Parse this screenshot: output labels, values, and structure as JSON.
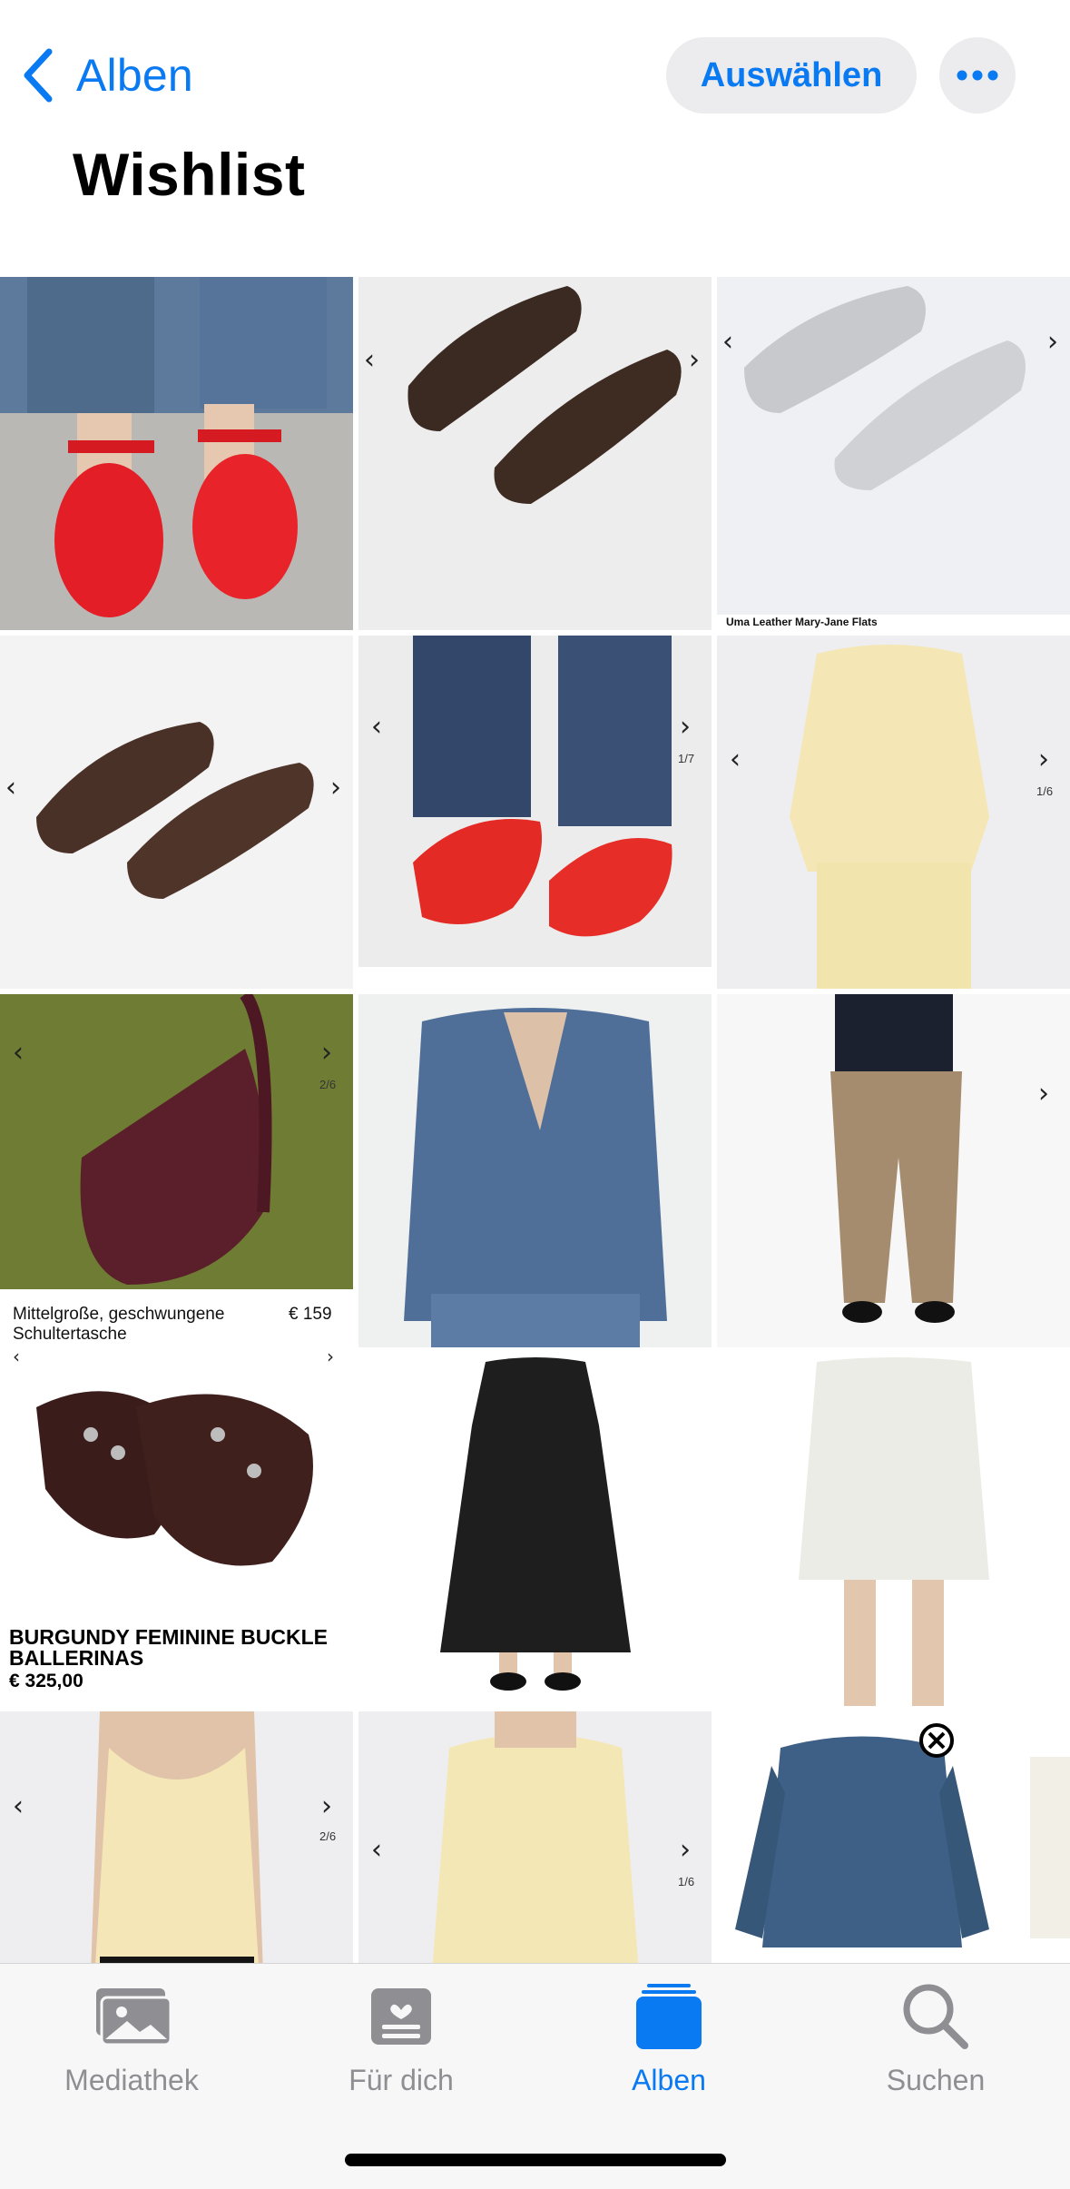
{
  "header": {
    "back_label": "Alben",
    "select_label": "Auswählen",
    "more_icon": "ellipsis-icon",
    "title": "Wishlist"
  },
  "colors": {
    "accent": "#0A7AF3",
    "inactive": "#8E8E93",
    "pill_bg": "#ECECEE"
  },
  "grid": {
    "tiles": [
      {
        "desc": "red mary-jane ballet flats with jeans"
      },
      {
        "desc": "brown suede ballet flats"
      },
      {
        "desc": "silver mary-jane flats",
        "caption": "Uma Leather Mary-Jane Flats"
      },
      {
        "desc": "brown leather flats"
      },
      {
        "desc": "red ballet flats with jeans",
        "page": "1/7"
      },
      {
        "desc": "yellow linen shirt and skirt",
        "page": "1/6"
      },
      {
        "desc": "burgundy crescent bag",
        "page": "2/6",
        "caption": "Mittelgroße, geschwungene Schultertasche",
        "price": "€ 159"
      },
      {
        "desc": "denim blazer and jeans"
      },
      {
        "desc": "leopard print trousers"
      },
      {
        "desc": "buckle ballerinas",
        "product_name": "BURGUNDY FEMININE BUCKLE BALLERINAS",
        "product_price": "€ 325,00"
      },
      {
        "desc": "black midi dress"
      },
      {
        "desc": "white mini dress"
      },
      {
        "desc": "yellow tank top",
        "page": "2/6"
      },
      {
        "desc": "yellow linen shirt",
        "page": "1/6"
      },
      {
        "desc": "denim overshirt"
      }
    ]
  },
  "tabbar": {
    "items": [
      {
        "label": "Mediathek",
        "icon": "photo-library-icon",
        "active": false
      },
      {
        "label": "Für dich",
        "icon": "for-you-icon",
        "active": false
      },
      {
        "label": "Alben",
        "icon": "albums-icon",
        "active": true
      },
      {
        "label": "Suchen",
        "icon": "search-icon",
        "active": false
      }
    ]
  }
}
